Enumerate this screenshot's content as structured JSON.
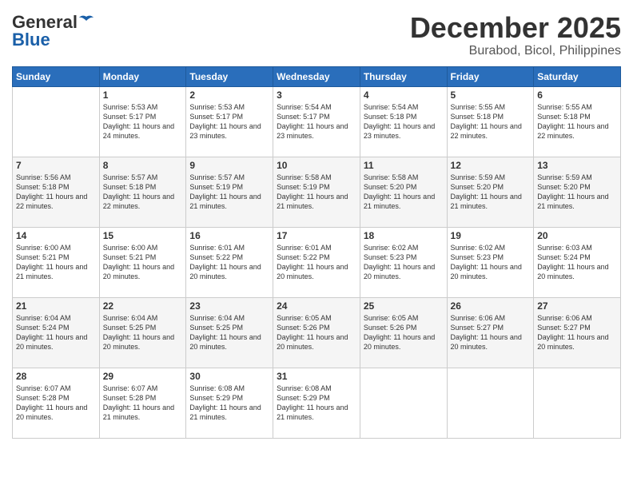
{
  "header": {
    "logo_general": "General",
    "logo_blue": "Blue",
    "month_title": "December 2025",
    "location": "Burabod, Bicol, Philippines"
  },
  "days_of_week": [
    "Sunday",
    "Monday",
    "Tuesday",
    "Wednesday",
    "Thursday",
    "Friday",
    "Saturday"
  ],
  "weeks": [
    [
      {
        "day": "",
        "sunrise": "",
        "sunset": "",
        "daylight": ""
      },
      {
        "day": "1",
        "sunrise": "Sunrise: 5:53 AM",
        "sunset": "Sunset: 5:17 PM",
        "daylight": "Daylight: 11 hours and 24 minutes."
      },
      {
        "day": "2",
        "sunrise": "Sunrise: 5:53 AM",
        "sunset": "Sunset: 5:17 PM",
        "daylight": "Daylight: 11 hours and 23 minutes."
      },
      {
        "day": "3",
        "sunrise": "Sunrise: 5:54 AM",
        "sunset": "Sunset: 5:17 PM",
        "daylight": "Daylight: 11 hours and 23 minutes."
      },
      {
        "day": "4",
        "sunrise": "Sunrise: 5:54 AM",
        "sunset": "Sunset: 5:18 PM",
        "daylight": "Daylight: 11 hours and 23 minutes."
      },
      {
        "day": "5",
        "sunrise": "Sunrise: 5:55 AM",
        "sunset": "Sunset: 5:18 PM",
        "daylight": "Daylight: 11 hours and 22 minutes."
      },
      {
        "day": "6",
        "sunrise": "Sunrise: 5:55 AM",
        "sunset": "Sunset: 5:18 PM",
        "daylight": "Daylight: 11 hours and 22 minutes."
      }
    ],
    [
      {
        "day": "7",
        "sunrise": "Sunrise: 5:56 AM",
        "sunset": "Sunset: 5:18 PM",
        "daylight": "Daylight: 11 hours and 22 minutes."
      },
      {
        "day": "8",
        "sunrise": "Sunrise: 5:57 AM",
        "sunset": "Sunset: 5:18 PM",
        "daylight": "Daylight: 11 hours and 22 minutes."
      },
      {
        "day": "9",
        "sunrise": "Sunrise: 5:57 AM",
        "sunset": "Sunset: 5:19 PM",
        "daylight": "Daylight: 11 hours and 21 minutes."
      },
      {
        "day": "10",
        "sunrise": "Sunrise: 5:58 AM",
        "sunset": "Sunset: 5:19 PM",
        "daylight": "Daylight: 11 hours and 21 minutes."
      },
      {
        "day": "11",
        "sunrise": "Sunrise: 5:58 AM",
        "sunset": "Sunset: 5:20 PM",
        "daylight": "Daylight: 11 hours and 21 minutes."
      },
      {
        "day": "12",
        "sunrise": "Sunrise: 5:59 AM",
        "sunset": "Sunset: 5:20 PM",
        "daylight": "Daylight: 11 hours and 21 minutes."
      },
      {
        "day": "13",
        "sunrise": "Sunrise: 5:59 AM",
        "sunset": "Sunset: 5:20 PM",
        "daylight": "Daylight: 11 hours and 21 minutes."
      }
    ],
    [
      {
        "day": "14",
        "sunrise": "Sunrise: 6:00 AM",
        "sunset": "Sunset: 5:21 PM",
        "daylight": "Daylight: 11 hours and 21 minutes."
      },
      {
        "day": "15",
        "sunrise": "Sunrise: 6:00 AM",
        "sunset": "Sunset: 5:21 PM",
        "daylight": "Daylight: 11 hours and 20 minutes."
      },
      {
        "day": "16",
        "sunrise": "Sunrise: 6:01 AM",
        "sunset": "Sunset: 5:22 PM",
        "daylight": "Daylight: 11 hours and 20 minutes."
      },
      {
        "day": "17",
        "sunrise": "Sunrise: 6:01 AM",
        "sunset": "Sunset: 5:22 PM",
        "daylight": "Daylight: 11 hours and 20 minutes."
      },
      {
        "day": "18",
        "sunrise": "Sunrise: 6:02 AM",
        "sunset": "Sunset: 5:23 PM",
        "daylight": "Daylight: 11 hours and 20 minutes."
      },
      {
        "day": "19",
        "sunrise": "Sunrise: 6:02 AM",
        "sunset": "Sunset: 5:23 PM",
        "daylight": "Daylight: 11 hours and 20 minutes."
      },
      {
        "day": "20",
        "sunrise": "Sunrise: 6:03 AM",
        "sunset": "Sunset: 5:24 PM",
        "daylight": "Daylight: 11 hours and 20 minutes."
      }
    ],
    [
      {
        "day": "21",
        "sunrise": "Sunrise: 6:04 AM",
        "sunset": "Sunset: 5:24 PM",
        "daylight": "Daylight: 11 hours and 20 minutes."
      },
      {
        "day": "22",
        "sunrise": "Sunrise: 6:04 AM",
        "sunset": "Sunset: 5:25 PM",
        "daylight": "Daylight: 11 hours and 20 minutes."
      },
      {
        "day": "23",
        "sunrise": "Sunrise: 6:04 AM",
        "sunset": "Sunset: 5:25 PM",
        "daylight": "Daylight: 11 hours and 20 minutes."
      },
      {
        "day": "24",
        "sunrise": "Sunrise: 6:05 AM",
        "sunset": "Sunset: 5:26 PM",
        "daylight": "Daylight: 11 hours and 20 minutes."
      },
      {
        "day": "25",
        "sunrise": "Sunrise: 6:05 AM",
        "sunset": "Sunset: 5:26 PM",
        "daylight": "Daylight: 11 hours and 20 minutes."
      },
      {
        "day": "26",
        "sunrise": "Sunrise: 6:06 AM",
        "sunset": "Sunset: 5:27 PM",
        "daylight": "Daylight: 11 hours and 20 minutes."
      },
      {
        "day": "27",
        "sunrise": "Sunrise: 6:06 AM",
        "sunset": "Sunset: 5:27 PM",
        "daylight": "Daylight: 11 hours and 20 minutes."
      }
    ],
    [
      {
        "day": "28",
        "sunrise": "Sunrise: 6:07 AM",
        "sunset": "Sunset: 5:28 PM",
        "daylight": "Daylight: 11 hours and 20 minutes."
      },
      {
        "day": "29",
        "sunrise": "Sunrise: 6:07 AM",
        "sunset": "Sunset: 5:28 PM",
        "daylight": "Daylight: 11 hours and 21 minutes."
      },
      {
        "day": "30",
        "sunrise": "Sunrise: 6:08 AM",
        "sunset": "Sunset: 5:29 PM",
        "daylight": "Daylight: 11 hours and 21 minutes."
      },
      {
        "day": "31",
        "sunrise": "Sunrise: 6:08 AM",
        "sunset": "Sunset: 5:29 PM",
        "daylight": "Daylight: 11 hours and 21 minutes."
      },
      {
        "day": "",
        "sunrise": "",
        "sunset": "",
        "daylight": ""
      },
      {
        "day": "",
        "sunrise": "",
        "sunset": "",
        "daylight": ""
      },
      {
        "day": "",
        "sunrise": "",
        "sunset": "",
        "daylight": ""
      }
    ]
  ]
}
